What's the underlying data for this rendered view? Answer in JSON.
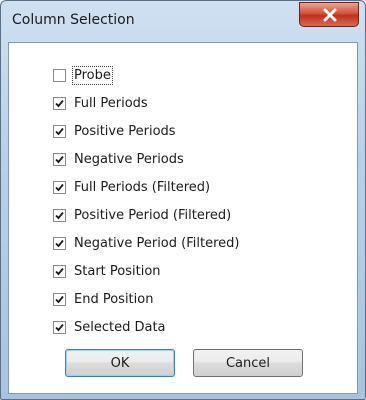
{
  "window": {
    "title": "Column Selection"
  },
  "options": [
    {
      "label": "Probe",
      "checked": false
    },
    {
      "label": "Full Periods",
      "checked": true
    },
    {
      "label": "Positive Periods",
      "checked": true
    },
    {
      "label": "Negative Periods",
      "checked": true
    },
    {
      "label": "Full Periods (Filtered)",
      "checked": true
    },
    {
      "label": "Positive Period (Filtered)",
      "checked": true
    },
    {
      "label": "Negative Period (Filtered)",
      "checked": true
    },
    {
      "label": "Start Position",
      "checked": true
    },
    {
      "label": "End Position",
      "checked": true
    },
    {
      "label": "Selected Data",
      "checked": true
    }
  ],
  "buttons": {
    "ok_label": "OK",
    "cancel_label": "Cancel"
  },
  "colors": {
    "close_button": "#c9402a",
    "frame": "#b9d0e8"
  },
  "icons": {
    "close": "close-icon",
    "check": "checkmark-icon"
  }
}
